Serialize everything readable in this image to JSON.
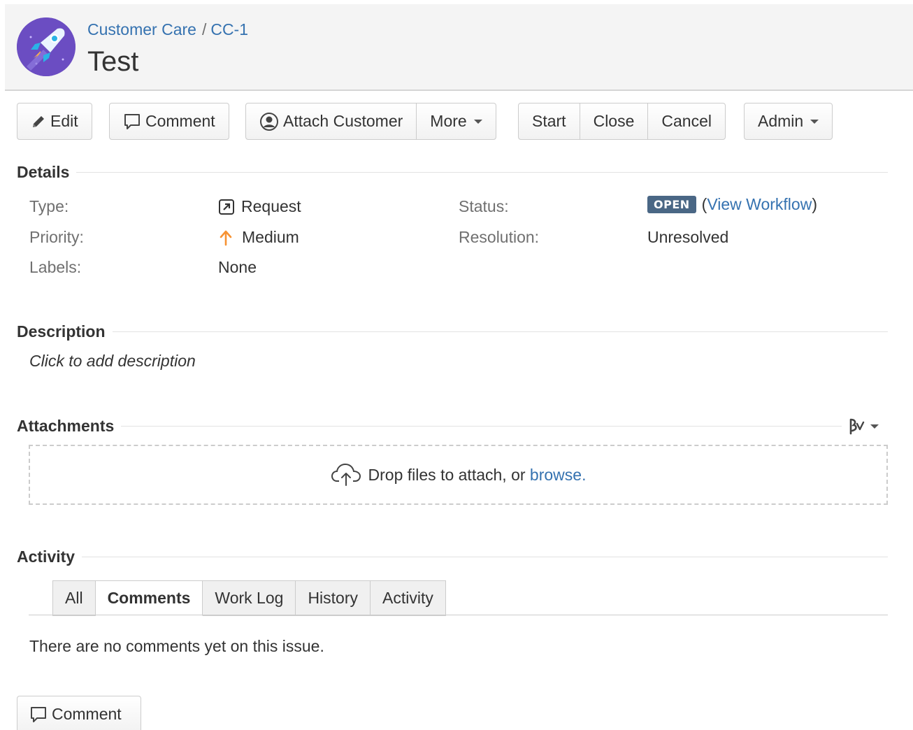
{
  "header": {
    "breadcrumbs": [
      "Customer Care",
      "CC-1"
    ],
    "breadcrumb_separator": "/",
    "title": "Test",
    "avatar_icon": "rocket-icon"
  },
  "toolbar": {
    "edit": "Edit",
    "comment": "Comment",
    "attach_customer": "Attach Customer",
    "more": "More",
    "start": "Start",
    "close": "Close",
    "cancel": "Cancel",
    "admin": "Admin"
  },
  "details": {
    "heading": "Details",
    "type_label": "Type:",
    "type_value": "Request",
    "priority_label": "Priority:",
    "priority_value": "Medium",
    "labels_label": "Labels:",
    "labels_value": "None",
    "status_label": "Status:",
    "status_value": "OPEN",
    "view_workflow_open": "(",
    "view_workflow": "View Workflow",
    "view_workflow_close": ")",
    "resolution_label": "Resolution:",
    "resolution_value": "Unresolved"
  },
  "description": {
    "heading": "Description",
    "placeholder": "Click to add description"
  },
  "attachments": {
    "heading": "Attachments",
    "drop_text": "Drop files to attach, or",
    "browse": "browse."
  },
  "activity": {
    "heading": "Activity",
    "tabs": [
      "All",
      "Comments",
      "Work Log",
      "History",
      "Activity"
    ],
    "active_tab": "Comments",
    "empty_message": "There are no comments yet on this issue.",
    "comment_button": "Comment"
  },
  "colors": {
    "link": "#3572b0",
    "status_lozenge": "#4a6785",
    "priority_medium": "#f79232",
    "avatar_bg": "#6b4dc2"
  }
}
